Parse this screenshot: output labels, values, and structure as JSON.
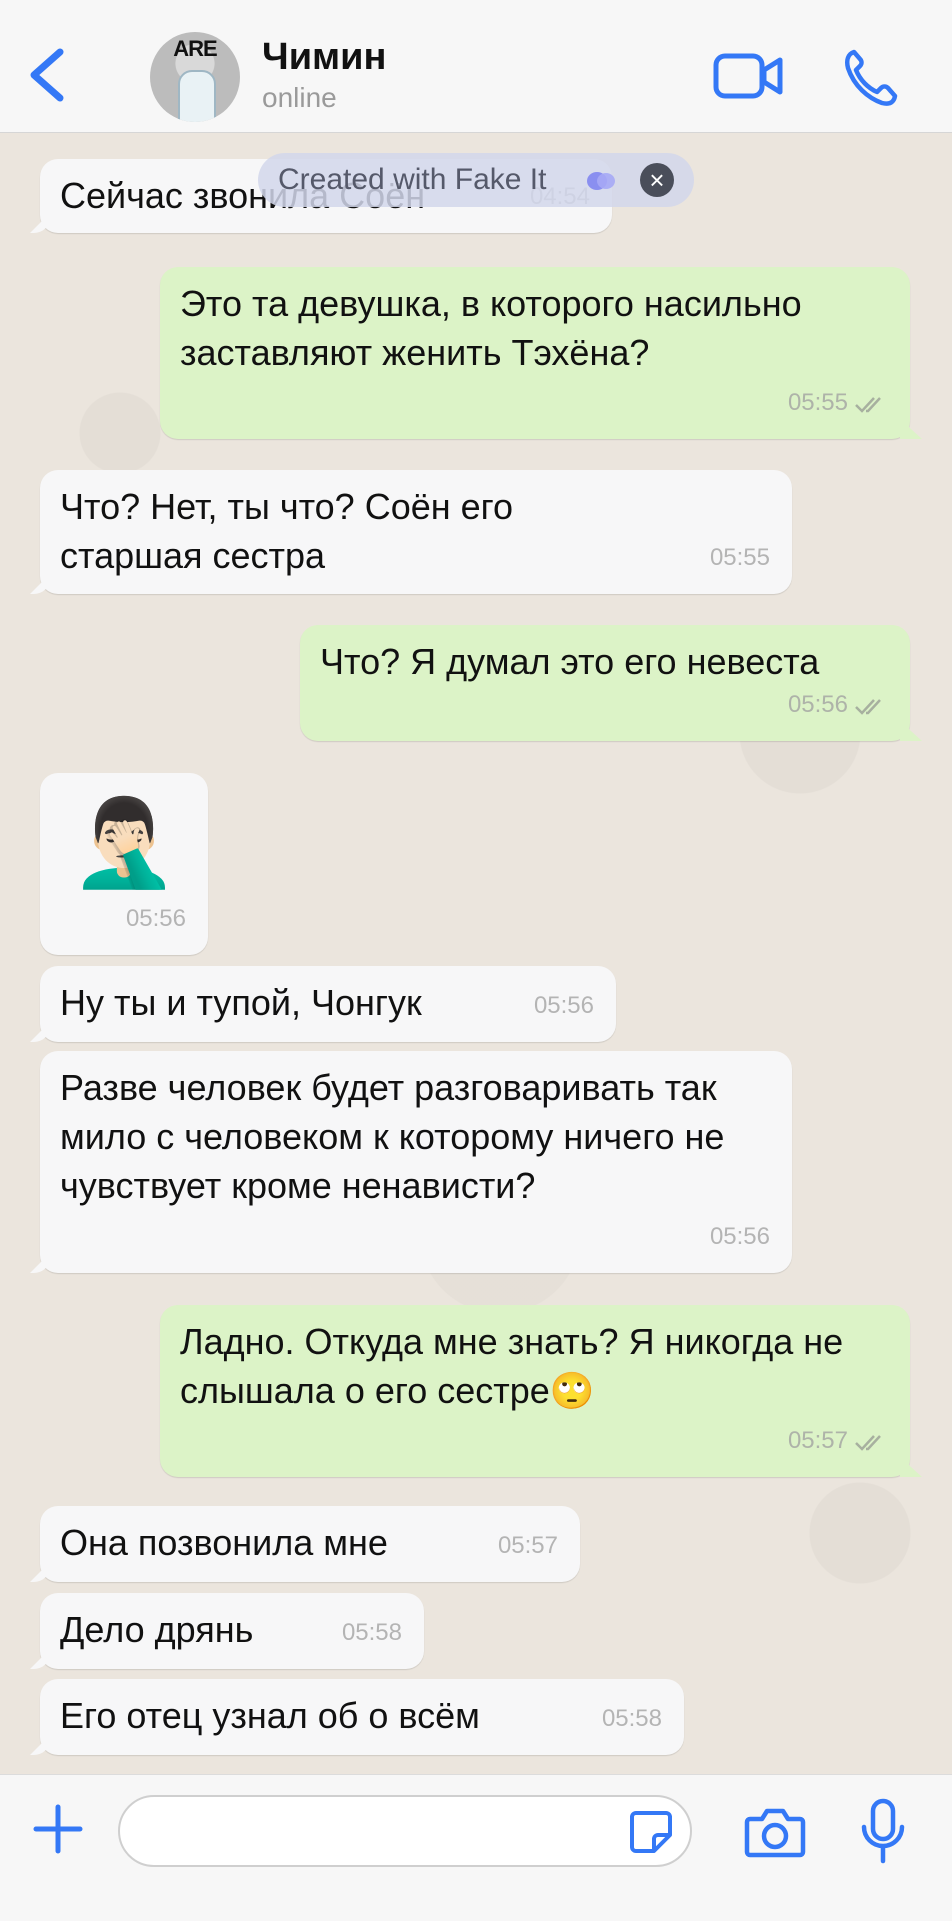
{
  "header": {
    "avatar_text": "ARE",
    "name": "Чимин",
    "status": "online"
  },
  "watermark": {
    "text": "Created with Fake It",
    "close": "×"
  },
  "messages": [
    {
      "dir": "in",
      "text": "Сейчас звонила Соён",
      "time": "04:54"
    },
    {
      "dir": "out",
      "text": "Это та девушка, в которого насильно заставляют женить Тэхёна?",
      "time": "05:55"
    },
    {
      "dir": "in",
      "text": "Что? Нет, ты что? Соён его старшая сестра",
      "time": "05:55"
    },
    {
      "dir": "out",
      "text": "Что? Я думал это его невеста",
      "time": "05:56"
    },
    {
      "dir": "in",
      "text": "🤦🏻‍♂️",
      "time": "05:56"
    },
    {
      "dir": "in",
      "text": "Ну ты и тупой, Чонгук",
      "time": "05:56"
    },
    {
      "dir": "in",
      "text": "Разве человек будет разговаривать так мило с человеком к которому ничего не чувствует кроме ненависти?",
      "time": "05:56"
    },
    {
      "dir": "out",
      "text": "Ладно. Откуда мне знать? Я никогда не слышала о его сестре🙄",
      "time": "05:57"
    },
    {
      "dir": "in",
      "text": "Она позвонила мне",
      "time": "05:57"
    },
    {
      "dir": "in",
      "text": "Дело дрянь",
      "time": "05:58"
    },
    {
      "dir": "in",
      "text": "Его отец узнал об о всём",
      "time": "05:58"
    }
  ],
  "input": {
    "value": "",
    "placeholder": ""
  },
  "colors": {
    "accent": "#3478f6",
    "incoming": "#f7f7f8",
    "outgoing": "#dcf3c7"
  },
  "icons": [
    "chevron-left-icon",
    "video-call-icon",
    "phone-icon",
    "plus-icon",
    "sticker-icon",
    "camera-icon",
    "microphone-icon",
    "double-check-icon"
  ]
}
